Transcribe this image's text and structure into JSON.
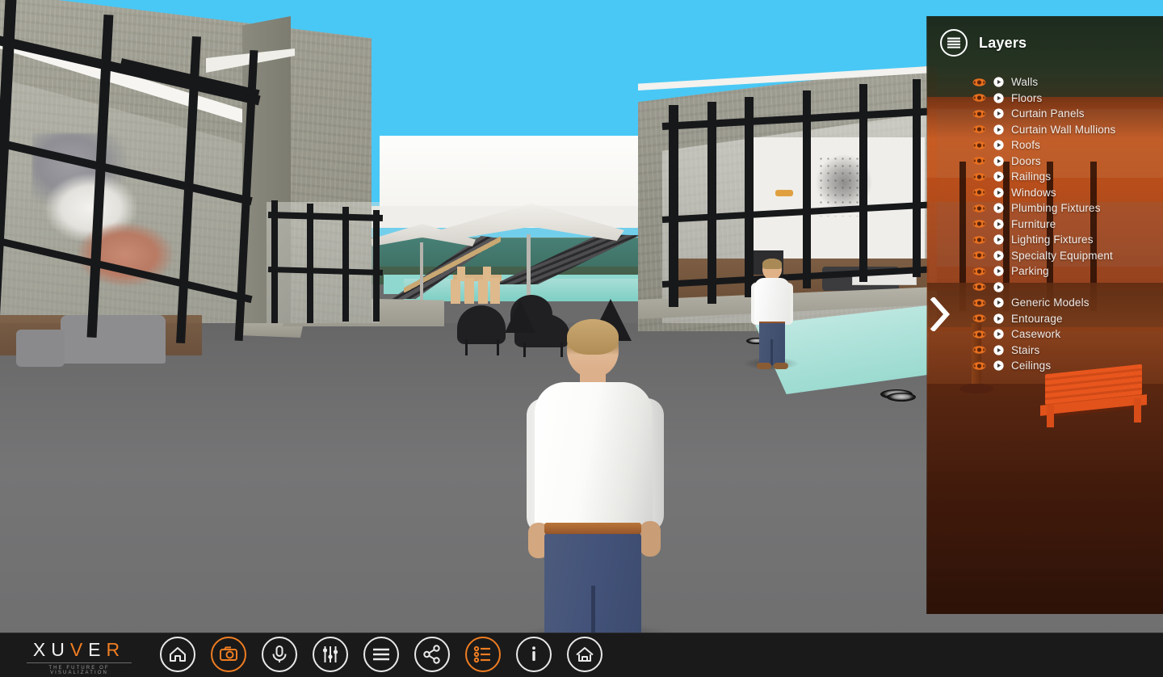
{
  "app": {
    "name": "Xuver",
    "logo_primary": "XUVER",
    "logo_letters": [
      {
        "ch": "X",
        "accent": false
      },
      {
        "ch": "U",
        "accent": false
      },
      {
        "ch": "V",
        "accent": true
      },
      {
        "ch": "E",
        "accent": false
      },
      {
        "ch": "R",
        "accent": true
      }
    ],
    "logo_tagline": "THE FUTURE OF VISUALIZATION",
    "accent_color": "#ef7d22",
    "bar_color": "#1a1a1a"
  },
  "viewport": {
    "name": "3d-scene-viewport",
    "description": "First-person architectural walkthrough of a courtyard with pool, umbrellas, lounge chairs and glass curtain walls",
    "avatars": 2
  },
  "panel": {
    "title": "Layers",
    "icon": "layers-icon",
    "collapse_icon": "chevron-right-icon",
    "row_visibility_icon": "eye-icon",
    "row_action_icon": "play-circle-icon",
    "eye_color": "#e8701f",
    "items": [
      {
        "label": "Walls",
        "visible": true
      },
      {
        "label": "Floors",
        "visible": true
      },
      {
        "label": "Curtain Panels",
        "visible": true
      },
      {
        "label": "Curtain Wall Mullions",
        "visible": true
      },
      {
        "label": "Roofs",
        "visible": true
      },
      {
        "label": "Doors",
        "visible": true
      },
      {
        "label": "Railings",
        "visible": true
      },
      {
        "label": "Windows",
        "visible": true
      },
      {
        "label": "Plumbing Fixtures",
        "visible": true
      },
      {
        "label": "Furniture",
        "visible": true
      },
      {
        "label": "Lighting Fixtures",
        "visible": true
      },
      {
        "label": "Specialty Equipment",
        "visible": true
      },
      {
        "label": "Parking",
        "visible": true
      },
      {
        "label": "",
        "visible": true
      },
      {
        "label": "Generic Models",
        "visible": true
      },
      {
        "label": "Entourage",
        "visible": true
      },
      {
        "label": "Casework",
        "visible": true
      },
      {
        "label": "Stairs",
        "visible": true
      },
      {
        "label": "Ceilings",
        "visible": true
      }
    ]
  },
  "toolbar": {
    "buttons": [
      {
        "name": "home-button",
        "icon": "home-icon",
        "label": "Home",
        "active": false
      },
      {
        "name": "screenshot-button",
        "icon": "camera-icon",
        "label": "Screenshot",
        "active": true
      },
      {
        "name": "microphone-button",
        "icon": "microphone-icon",
        "label": "Microphone",
        "active": false
      },
      {
        "name": "settings-sliders-button",
        "icon": "sliders-icon",
        "label": "Settings",
        "active": false
      },
      {
        "name": "menu-button",
        "icon": "hamburger-menu-icon",
        "label": "Menu",
        "active": false
      },
      {
        "name": "share-button",
        "icon": "share-nodes-icon",
        "label": "Share",
        "active": false
      },
      {
        "name": "layers-button",
        "icon": "layers-list-icon",
        "label": "Layers",
        "active": true
      },
      {
        "name": "info-button",
        "icon": "info-icon",
        "label": "Info",
        "active": false
      },
      {
        "name": "model-view-button",
        "icon": "house-outline-icon",
        "label": "Model View",
        "active": false
      }
    ]
  }
}
